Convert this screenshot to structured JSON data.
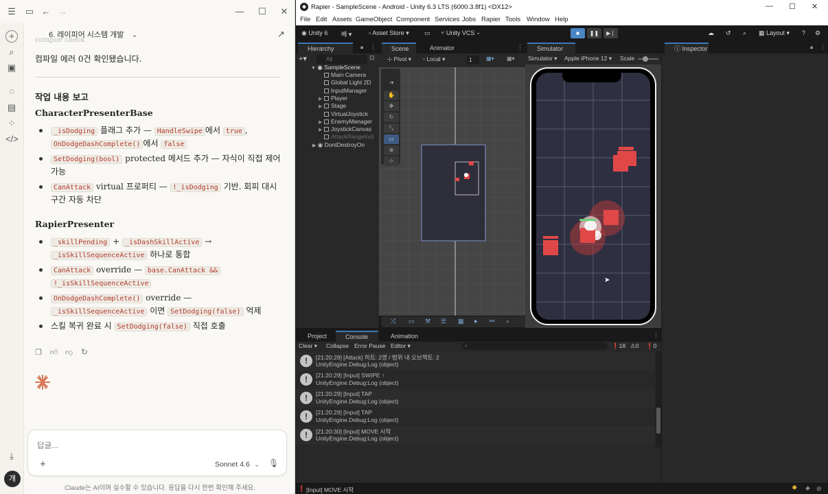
{
  "claude": {
    "conversation_title": "6. 레이피어 시스템 개발",
    "partial_top_text": "compile check",
    "compile_msg": "컴파일 에러 0건 확인됐습니다.",
    "report_heading": "작업 내용 보고",
    "section1_title": "CharacterPresenterBase",
    "s1_b1_code1": "_isDodging",
    "s1_b1_t1": " 플래그 추가 — ",
    "s1_b1_code2": "HandleSwipe",
    "s1_b1_t2": "에서 ",
    "s1_b1_code3": "true",
    "s1_b1_t3": ",",
    "s1_b1_code4": "OnDodgeDashComplete()",
    "s1_b1_t4": "에서 ",
    "s1_b1_code5": "false",
    "s1_b2_code1": "SetDodging(bool)",
    "s1_b2_t1": " protected 메서드 추가 — 자식이 직접 제어",
    "s1_b2_t2": "가능",
    "s1_b3_code1": "CanAttack",
    "s1_b3_t1": " virtual 프로퍼티 — ",
    "s1_b3_code2": "!_isDodging",
    "s1_b3_t2": " 기반. 회피 대시",
    "s1_b3_t3": "구간 자동 차단",
    "section2_title": "RapierPresenter",
    "s2_b1_code1": "_skillPending",
    "s2_b1_t1": " + ",
    "s2_b1_code2": "_isDashSkillActive",
    "s2_b1_t2": " →",
    "s2_b1_code3": "_isSkillSequenceActive",
    "s2_b1_t3": " 하나로 통합",
    "s2_b2_code1": "CanAttack",
    "s2_b2_t1": " override — ",
    "s2_b2_code2": "base.CanAttack &&",
    "s2_b2_code3": "!_isSkillSequenceActive",
    "s2_b3_code1": "OnDodgeDashComplete()",
    "s2_b3_t1": " override —",
    "s2_b3_code2": "_isSkillSequenceActive",
    "s2_b3_t2": " 이면 ",
    "s2_b3_code3": "SetDodging(false)",
    "s2_b3_t3": " 억제",
    "s2_b4_t1": "스킬 복귀 완료 시 ",
    "s2_b4_code1": "SetDodging(false)",
    "s2_b4_t2": " 직접 호출",
    "input_placeholder": "답글...",
    "model_name": "Sonnet 4.6",
    "disclaimer": "Claude는 AI이며 실수할 수 있습니다. 응답을 다시 한번 확인해 주세요.",
    "avatar_initial": "개",
    "accent_color": "#d97757"
  },
  "unity": {
    "window_title": "Rapier - SampleScene - Android - Unity 6.3 LTS (6000.3.8f1) <DX12>",
    "menu": [
      "File",
      "Edit",
      "Assets",
      "GameObject",
      "Component",
      "Services",
      "Jobs",
      "Rapier",
      "Tools",
      "Window",
      "Help"
    ],
    "toolbar": {
      "account": "Unity 6",
      "branch": "베",
      "asset_store": "Asset Store",
      "vcs": "Unity VCS",
      "layout": "Layout"
    },
    "hierarchy": {
      "tab": "Hierarchy",
      "search_placeholder": "All",
      "scene": "SampleScene",
      "items": [
        "Main Camera",
        "Global Light 2D",
        "InputManager",
        "Player",
        "Stage",
        "VirtualJoystick",
        "EnemyManager",
        "JoystickCanvas",
        "AttackRangeIndi"
      ],
      "dont_destroy": "DontDestroyOn"
    },
    "scene": {
      "tab_scene": "Scene",
      "tab_animator": "Animator",
      "pivot": "Pivot",
      "local": "Local",
      "snap_value": "1"
    },
    "simulator": {
      "tab": "Simulator",
      "mode": "Simulator",
      "device": "Apple iPhone 12",
      "scale_label": "Scale"
    },
    "inspector": {
      "tab": "Inspector"
    },
    "bottom_tabs": [
      "Project",
      "Console",
      "Animation"
    ],
    "console": {
      "clear": "Clear",
      "collapse": "Collapse",
      "error_pause": "Error Pause",
      "editor": "Editor",
      "count_info": "18",
      "count_warn": "0",
      "count_error": "0",
      "logs": [
        {
          "line1": "[21:20:29] [Attack] 히트: 2명 / 범위 내 오브젝트: 2",
          "line2": "UnityEngine.Debug:Log (object)"
        },
        {
          "line1": "[21:20:29] [Input] SWIPE ↑",
          "line2": "UnityEngine.Debug:Log (object)"
        },
        {
          "line1": "[21:20:29] [Input] TAP",
          "line2": "UnityEngine.Debug:Log (object)"
        },
        {
          "line1": "[21:20:29] [Input] TAP",
          "line2": "UnityEngine.Debug:Log (object)"
        },
        {
          "line1": "[21:20:30] [Input] MOVE 시작",
          "line2": "UnityEngine.Debug:Log (object)"
        }
      ]
    },
    "status_bar": "[Input] MOVE 시작"
  }
}
